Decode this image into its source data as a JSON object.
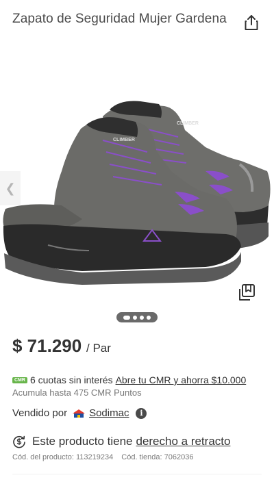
{
  "product": {
    "title": "Zapato de Seguridad Mujer Gardena"
  },
  "gallery": {
    "image_alt": "Zapato de Seguridad Mujer Gardena",
    "brand_print": "CLIMBER",
    "current_page": 1,
    "total_pages": 4
  },
  "pricing": {
    "price": "$ 71.290",
    "unit": "/ Par"
  },
  "cmr": {
    "badge": "CMR",
    "installments": "6 cuotas sin interés",
    "link": "Abre tu CMR y ahorra $10.000",
    "points": "Acumula hasta 475 CMR Puntos"
  },
  "seller": {
    "label": "Vendido por",
    "name": "Sodimac",
    "info_glyph": "i"
  },
  "retract": {
    "text": "Este producto tiene",
    "link": "derecho a retracto"
  },
  "codes": {
    "product_code": "Cód. del producto: 113219234",
    "store_code": "Cód. tienda: 7062036"
  },
  "icons": {
    "share": "share-icon",
    "save": "copy-save-icon",
    "prev": "chevron-left-icon",
    "next": "chevron-right-icon",
    "retract": "refund-icon",
    "info": "info-icon"
  },
  "colors": {
    "cmr_green": "#68b54b",
    "pager_bg": "#6a6a6a",
    "shoe_gray": "#6e6e6b",
    "shoe_purple": "#8a4fc9"
  }
}
